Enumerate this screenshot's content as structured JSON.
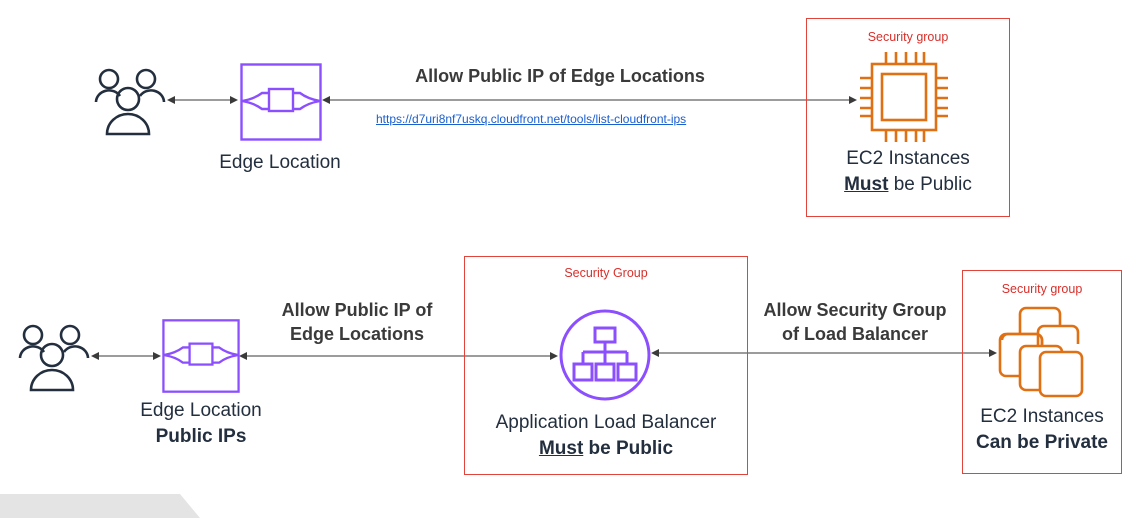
{
  "top_row": {
    "arrow_label": "Allow Public IP of Edge Locations",
    "link_text": "https://d7uri8nf7uskq.cloudfront.net/tools/list-cloudfront-ips",
    "edge_caption": "Edge Location",
    "security_group_label": "Security group",
    "ec2_caption_line1": "EC2 Instances",
    "ec2_must": "Must",
    "ec2_rest": " be Public"
  },
  "bottom_row": {
    "arrow1_label_line1": "Allow Public IP of",
    "arrow1_label_line2": "Edge Locations",
    "edge_caption_line1": "Edge Location",
    "edge_caption_line2": "Public IPs",
    "alb_security_group_label": "Security Group",
    "alb_caption_line1": "Application Load Balancer",
    "alb_must": "Must",
    "alb_rest": " be Public",
    "arrow2_label_line1": "Allow Security Group",
    "arrow2_label_line2": "of Load Balancer",
    "ec2_security_group_label": "Security group",
    "ec2_caption_line1": "EC2 Instances",
    "ec2_caption_line2": "Can be Private"
  },
  "colors": {
    "security_border": "#e0443a",
    "security_text": "#d8302b",
    "edge_icon": "#8c4fff",
    "alb_icon": "#8c4fff",
    "ec2_icon": "#e07014",
    "users_icon": "#232f3e",
    "link": "#1a5fd0"
  }
}
